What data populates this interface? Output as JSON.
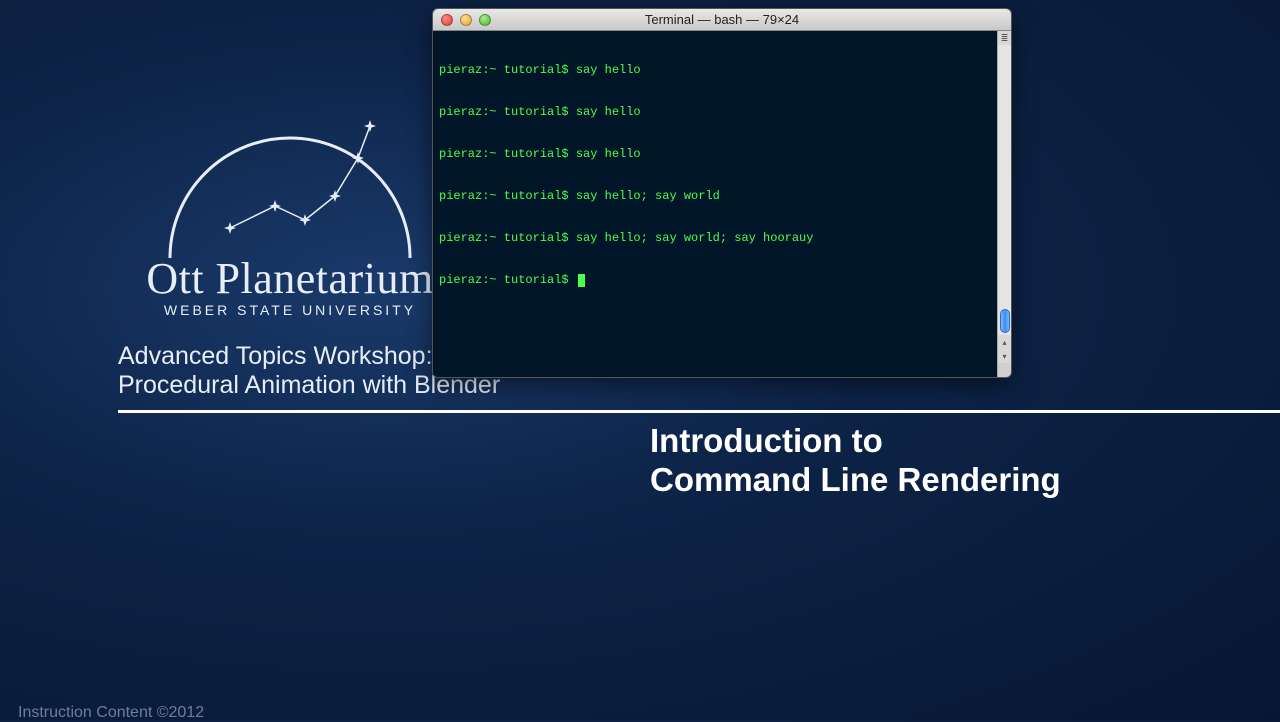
{
  "logo": {
    "main": "Ott Planetarium",
    "sub": "WEBER STATE UNIVERSITY"
  },
  "workshop": {
    "line1": "Advanced Topics Workshop:",
    "line2": "Procedural Animation with Blender"
  },
  "section": {
    "line1": "Introduction to",
    "line2": "Command Line Rendering"
  },
  "footer": "Instruction Content ©2012",
  "terminal": {
    "title": "Terminal — bash — 79×24",
    "prompt": "pieraz:~ tutorial$ ",
    "lines": [
      "pieraz:~ tutorial$ say hello",
      "pieraz:~ tutorial$ say hello",
      "pieraz:~ tutorial$ say hello",
      "pieraz:~ tutorial$ say hello; say world",
      "pieraz:~ tutorial$ say hello; say world; say hoorauy",
      "pieraz:~ tutorial$ "
    ]
  }
}
